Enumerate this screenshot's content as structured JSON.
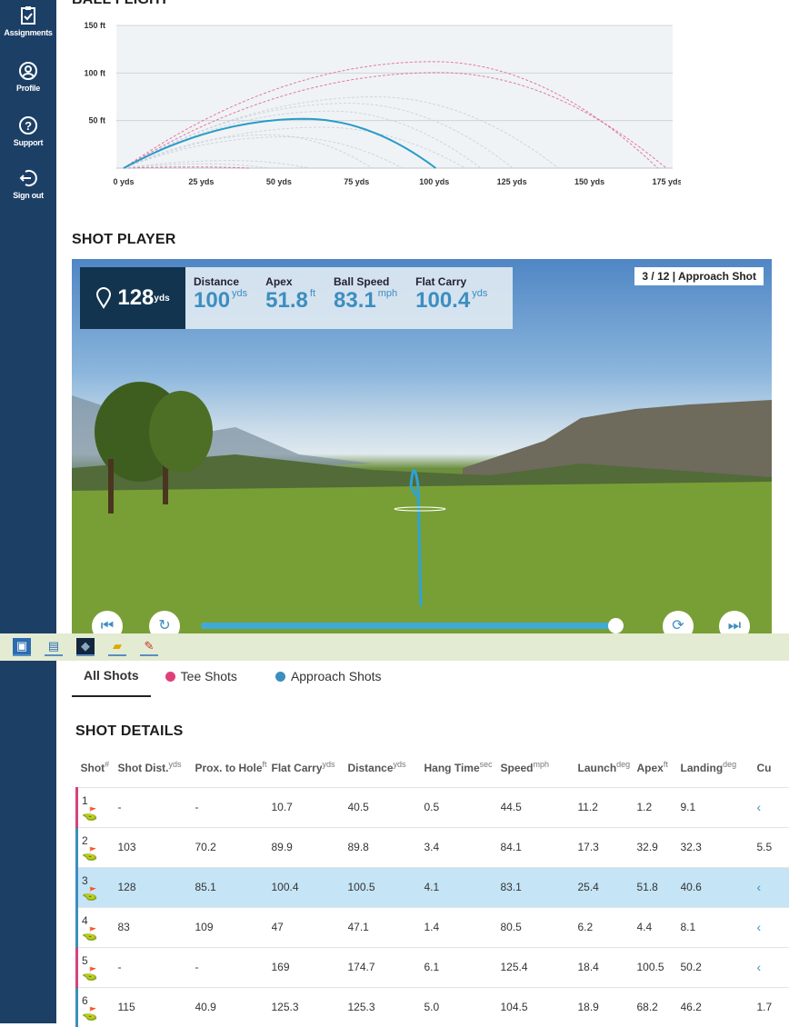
{
  "sidebar": {
    "items": [
      {
        "label": "Assignments",
        "icon": "clipboard-check-icon"
      },
      {
        "label": "Profile",
        "icon": "user-circle-icon"
      },
      {
        "label": "Support",
        "icon": "question-circle-icon"
      },
      {
        "label": "Sign out",
        "icon": "sign-out-icon"
      }
    ]
  },
  "ball_flight": {
    "title": "BALL FLIGHT"
  },
  "chart_data": {
    "type": "line",
    "title": "BALL FLIGHT",
    "xlim": [
      0,
      175
    ],
    "ylim": [
      0,
      150
    ],
    "x_ticks": [
      "0 yds",
      "25 yds",
      "50 yds",
      "75 yds",
      "100 yds",
      "125 yds",
      "150 yds",
      "175 yds"
    ],
    "y_ticks": [
      "50 ft",
      "100 ft",
      "150 ft"
    ],
    "grid": true,
    "colors": {
      "tee": "#e05a8a",
      "approach": "#2a9bc8",
      "other": "#c5cdd6"
    },
    "trajectories": [
      {
        "shot": 1,
        "type": "tee",
        "distance": 40.5,
        "apex": 1.2
      },
      {
        "shot": 2,
        "type": "approach",
        "distance": 89.8,
        "apex": 32.9
      },
      {
        "shot": 3,
        "type": "approach",
        "distance": 100.5,
        "apex": 51.8,
        "selected": true
      },
      {
        "shot": 4,
        "type": "approach",
        "distance": 47.1,
        "apex": 4.4
      },
      {
        "shot": 5,
        "type": "tee",
        "distance": 174.7,
        "apex": 100.5
      },
      {
        "shot": 6,
        "type": "approach",
        "distance": 125.3,
        "apex": 68.2
      },
      {
        "type": "tee",
        "distance": 172,
        "apex": 112
      },
      {
        "type": "approach",
        "distance": 140,
        "apex": 75
      },
      {
        "type": "approach",
        "distance": 115,
        "apex": 60
      },
      {
        "type": "approach",
        "distance": 110,
        "apex": 43
      },
      {
        "type": "approach",
        "distance": 80,
        "apex": 35
      },
      {
        "type": "approach",
        "distance": 60,
        "apex": 8
      }
    ]
  },
  "shot_player": {
    "title": "SHOT PLAYER",
    "to_hole": "128",
    "to_hole_unit": "yds",
    "metrics": [
      {
        "label": "Distance",
        "value": "100",
        "unit": "yds"
      },
      {
        "label": "Apex",
        "value": "51.8",
        "unit": "ft"
      },
      {
        "label": "Ball Speed",
        "value": "83.1",
        "unit": "mph"
      },
      {
        "label": "Flat Carry",
        "value": "100.4",
        "unit": "yds"
      }
    ],
    "badge": "3 / 12 | Approach Shot",
    "progress": 0.99
  },
  "tabs": [
    {
      "label": "All Shots",
      "active": true
    },
    {
      "label": "Tee Shots",
      "color": "#e0407a"
    },
    {
      "label": "Approach Shots",
      "color": "#3c8ec0"
    }
  ],
  "shot_details": {
    "title": "SHOT DETAILS",
    "headers": [
      [
        "Shot",
        "#"
      ],
      [
        "Shot Dist.",
        "yds"
      ],
      [
        "Prox. to Hole",
        "ft"
      ],
      [
        "Flat Carry",
        "yds"
      ],
      [
        "Distance",
        "yds"
      ],
      [
        "Hang Time",
        "sec"
      ],
      [
        "Speed",
        "mph"
      ],
      [
        "Launch",
        "deg"
      ],
      [
        "Apex",
        "ft"
      ],
      [
        "Landing",
        "deg"
      ],
      [
        "Cu",
        ""
      ]
    ],
    "rows": [
      {
        "shot": "1",
        "type": "tee",
        "cells": [
          "-",
          "-",
          "10.7",
          "40.5",
          "0.5",
          "44.5",
          "11.2",
          "1.2",
          "9.1",
          "‹"
        ]
      },
      {
        "shot": "2",
        "type": "approach",
        "cells": [
          "103",
          "70.2",
          "89.9",
          "89.8",
          "3.4",
          "84.1",
          "17.3",
          "32.9",
          "32.3",
          "5.5"
        ]
      },
      {
        "shot": "3",
        "type": "approach",
        "selected": true,
        "cells": [
          "128",
          "85.1",
          "100.4",
          "100.5",
          "4.1",
          "83.1",
          "25.4",
          "51.8",
          "40.6",
          "‹"
        ]
      },
      {
        "shot": "4",
        "type": "approach",
        "cells": [
          "83",
          "109",
          "47",
          "47.1",
          "1.4",
          "80.5",
          "6.2",
          "4.4",
          "8.1",
          "‹"
        ]
      },
      {
        "shot": "5",
        "type": "tee",
        "cells": [
          "-",
          "-",
          "169",
          "174.7",
          "6.1",
          "125.4",
          "18.4",
          "100.5",
          "50.2",
          "‹"
        ]
      },
      {
        "shot": "6",
        "type": "approach",
        "cells": [
          "115",
          "40.9",
          "125.3",
          "125.3",
          "5.0",
          "104.5",
          "18.9",
          "68.2",
          "46.2",
          "1.7"
        ]
      }
    ]
  }
}
